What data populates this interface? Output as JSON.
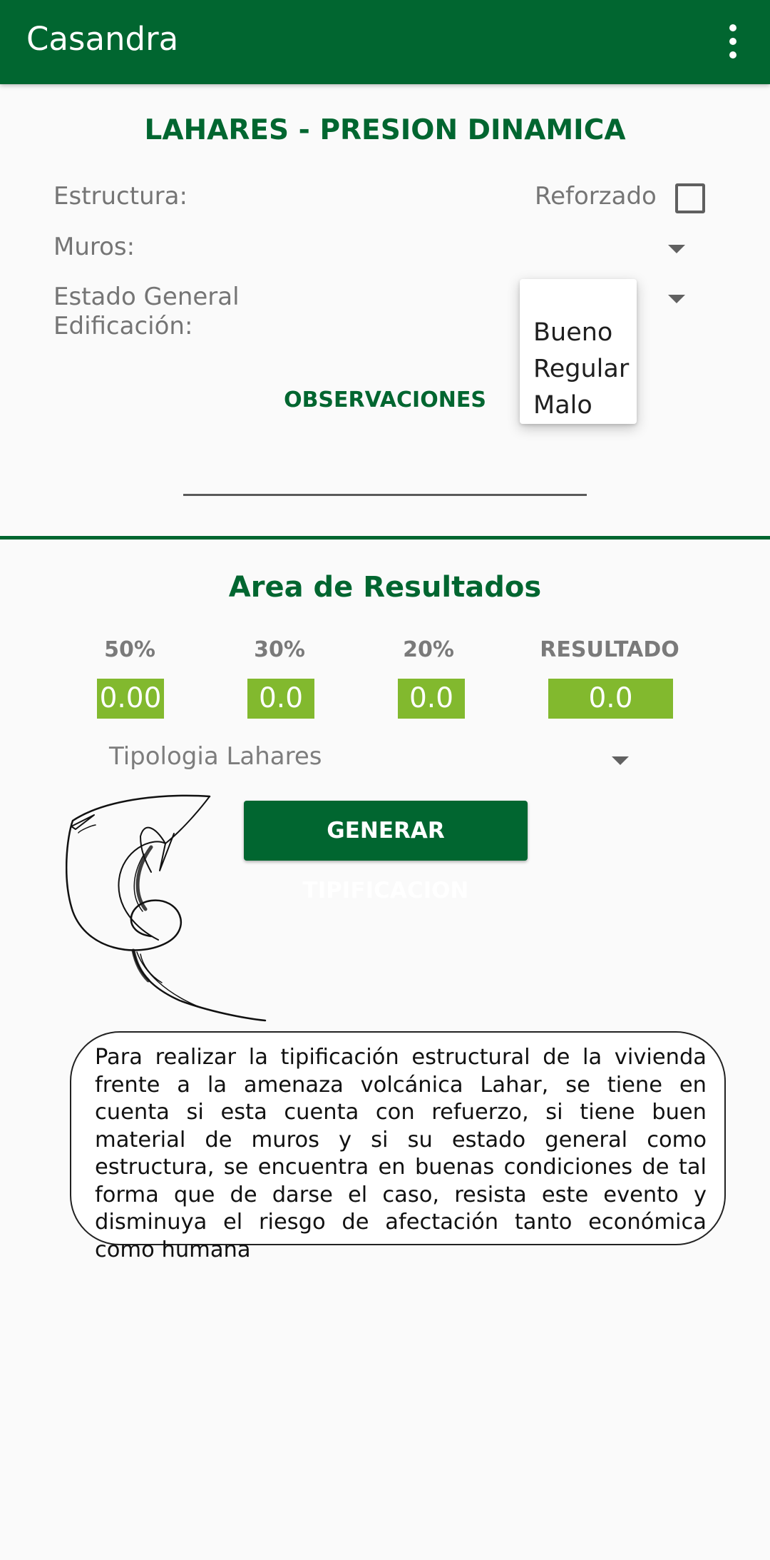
{
  "appbar": {
    "title": "Casandra"
  },
  "form": {
    "title": "LAHARES - PRESION DINAMICA",
    "estructura_label": "Estructura:",
    "reforzado_label": "Reforzado",
    "reforzado_checked": false,
    "muros_label": "Muros:",
    "estado_label_line1": "Estado General",
    "estado_label_line2": "Edificación:",
    "estado_options": [
      "Bueno",
      "Regular",
      "Malo"
    ],
    "observaciones_button": "OBSERVACIONES",
    "observaciones_value": ""
  },
  "results": {
    "title": "Area de Resultados",
    "columns": [
      {
        "label": "50%",
        "value": "0.00"
      },
      {
        "label": "30%",
        "value": "0.0"
      },
      {
        "label": "20%",
        "value": "0.0"
      },
      {
        "label": "RESULTADO",
        "value": "0.0"
      }
    ],
    "tipologia_label": "Tipologia Lahares",
    "generate_button": "GENERAR TIPIFICACION"
  },
  "info": {
    "text": "Para realizar la tipificación estructural de la vivienda frente a la amenaza volcánica Lahar, se tiene en cuenta si esta cuenta con refuerzo, si tiene buen material de muros y si su estado general como estructura, se encuentra en buenas condiciones de tal forma que de darse el caso, resista este evento y disminuya el riesgo de afectación tanto económica como humana"
  },
  "colors": {
    "primary": "#016630",
    "value_box": "#82b92e",
    "label_gray": "#757575"
  },
  "icons": [
    "overflow-menu-icon",
    "dropdown-arrow-icon",
    "lahar-wave-logo-icon"
  ]
}
